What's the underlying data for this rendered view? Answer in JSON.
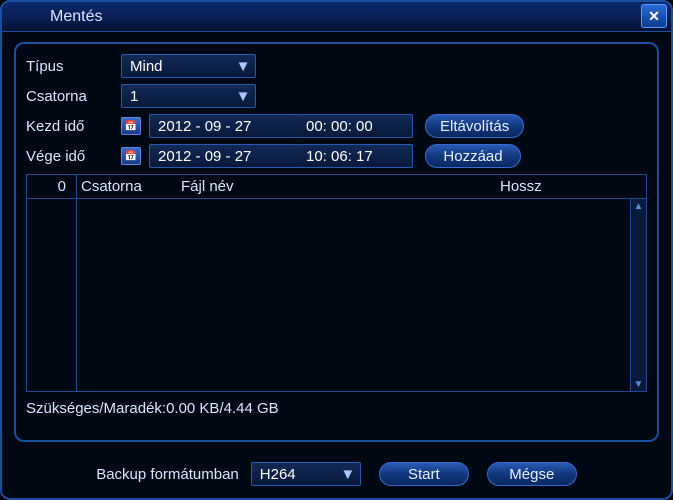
{
  "window": {
    "title": "Mentés"
  },
  "form": {
    "type_label": "Típus",
    "type_value": "Mind",
    "channel_label": "Csatorna",
    "channel_value": "1",
    "start_label": "Kezd idő",
    "start_date": "2012 - 09 - 27",
    "start_time": "00: 00: 00",
    "end_label": "Vége idő",
    "end_date": "2012 - 09 - 27",
    "end_time": "10: 06: 17",
    "remove_btn": "Eltávolítás",
    "add_btn": "Hozzáad"
  },
  "table": {
    "count": "0",
    "col_channel": "Csatorna",
    "col_filename": "Fájl név",
    "col_length": "Hossz"
  },
  "status": {
    "text": "Szükséges/Maradék:0.00 KB/4.44 GB"
  },
  "footer": {
    "format_label": "Backup formátumban",
    "format_value": "H264",
    "start_btn": "Start",
    "cancel_btn": "Mégse"
  }
}
